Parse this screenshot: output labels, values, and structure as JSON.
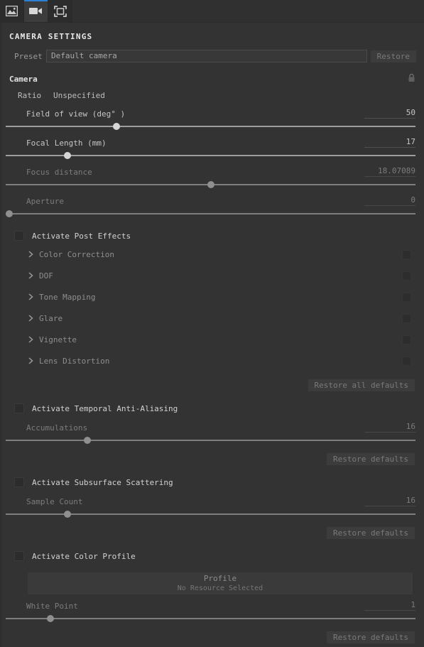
{
  "toolbar": {
    "buttons": [
      {
        "name": "image-icon",
        "label": "Image"
      },
      {
        "name": "video-camera-icon",
        "label": "Camera"
      },
      {
        "name": "frame-icon",
        "label": "Frame"
      }
    ],
    "active_index": 1,
    "accent_color": "#2a7fd4"
  },
  "page_title": "CAMERA SETTINGS",
  "preset": {
    "label": "Preset",
    "value": "Default camera",
    "placeholder": "Default camera",
    "restore_label": "Restore"
  },
  "camera": {
    "header": "Camera",
    "lock_icon": "lock-icon",
    "ratio": {
      "label": "Ratio",
      "value": "Unspecified"
    },
    "sliders": [
      {
        "label": "Field of view (deg° )",
        "value": "50",
        "fill": 27,
        "enabled": true
      },
      {
        "label": "Focal Length (mm)",
        "value": "17",
        "fill": 15,
        "enabled": true
      },
      {
        "label": "Focus distance",
        "value": "18.07089",
        "fill": 50,
        "enabled": false
      },
      {
        "label": "Aperture",
        "value": "0",
        "fill": 0,
        "enabled": false
      }
    ]
  },
  "post_effects": {
    "toggle_label": "Activate Post Effects",
    "checked": false,
    "items": [
      {
        "label": "Color Correction",
        "checked": false,
        "expanded": false
      },
      {
        "label": "DOF",
        "checked": false,
        "expanded": false
      },
      {
        "label": "Tone Mapping",
        "checked": false,
        "expanded": false
      },
      {
        "label": "Glare",
        "checked": false,
        "expanded": false
      },
      {
        "label": "Vignette",
        "checked": false,
        "expanded": false
      },
      {
        "label": "Lens Distortion",
        "checked": false,
        "expanded": false
      }
    ],
    "restore_label": "Restore all defaults"
  },
  "taa": {
    "toggle_label": "Activate Temporal Anti-Aliasing",
    "checked": false,
    "slider": {
      "label": "Accumulations",
      "value": "16",
      "fill": 20,
      "enabled": false
    },
    "restore_label": "Restore defaults"
  },
  "sss": {
    "toggle_label": "Activate Subsurface Scattering",
    "checked": false,
    "slider": {
      "label": "Sample Count",
      "value": "16",
      "fill": 15,
      "enabled": false
    },
    "restore_label": "Restore defaults"
  },
  "color_profile": {
    "toggle_label": "Activate Color Profile",
    "checked": false,
    "profile": {
      "title": "Profile",
      "subtitle": "No Resource Selected"
    },
    "slider": {
      "label": "White Point",
      "value": "1",
      "fill": 11,
      "enabled": false
    },
    "restore_label": "Restore defaults"
  }
}
